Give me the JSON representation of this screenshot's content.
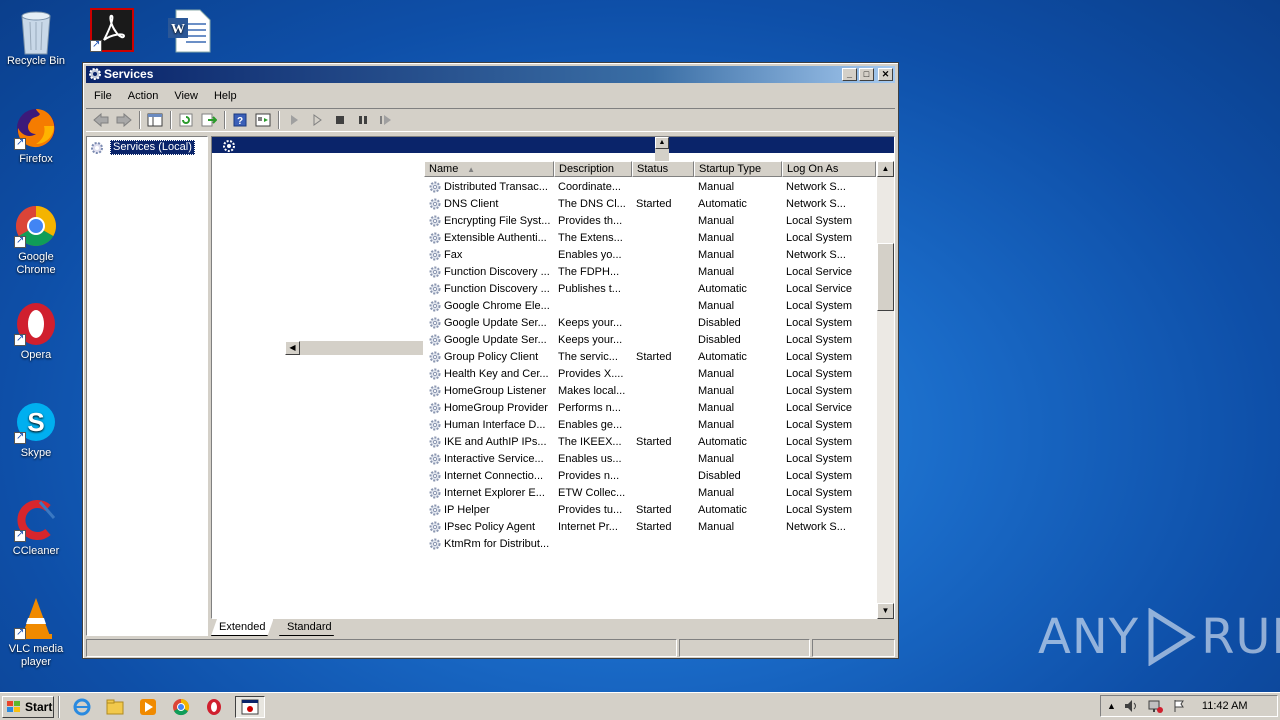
{
  "desktop": {
    "icons": [
      {
        "label": "Recycle Bin",
        "icon": "recycle-bin-icon"
      },
      {
        "label": "",
        "icon": "acrobat-icon"
      },
      {
        "label": "",
        "icon": "word-doc-icon"
      },
      {
        "label": "Firefox",
        "icon": "firefox-icon"
      },
      {
        "label": "Google Chrome",
        "icon": "chrome-icon"
      },
      {
        "label": "Opera",
        "icon": "opera-icon"
      },
      {
        "label": "Skype",
        "icon": "skype-icon"
      },
      {
        "label": "CCleaner",
        "icon": "ccleaner-icon"
      },
      {
        "label": "VLC media player",
        "icon": "vlc-icon"
      }
    ]
  },
  "window": {
    "title": "Services",
    "controls": {
      "minimize": "_",
      "maximize": "□",
      "close": "✕"
    },
    "menu": [
      "File",
      "Action",
      "View",
      "Help"
    ],
    "tree": {
      "root": "Services (Local)"
    },
    "columns": [
      "Name",
      "Description",
      "Status",
      "Startup Type",
      "Log On As"
    ],
    "services": [
      {
        "name": "Distributed Transac...",
        "description": "Coordinate...",
        "status": "",
        "startup": "Manual",
        "logon": "Network S..."
      },
      {
        "name": "DNS Client",
        "description": "The DNS Cl...",
        "status": "Started",
        "startup": "Automatic",
        "logon": "Network S..."
      },
      {
        "name": "Encrypting File Syst...",
        "description": "Provides th...",
        "status": "",
        "startup": "Manual",
        "logon": "Local System"
      },
      {
        "name": "Extensible Authenti...",
        "description": "The Extens...",
        "status": "",
        "startup": "Manual",
        "logon": "Local System"
      },
      {
        "name": "Fax",
        "description": "Enables yo...",
        "status": "",
        "startup": "Manual",
        "logon": "Network S..."
      },
      {
        "name": "Function Discovery ...",
        "description": "The FDPH...",
        "status": "",
        "startup": "Manual",
        "logon": "Local Service"
      },
      {
        "name": "Function Discovery ...",
        "description": "Publishes t...",
        "status": "",
        "startup": "Automatic",
        "logon": "Local Service"
      },
      {
        "name": "Google Chrome Ele...",
        "description": "",
        "status": "",
        "startup": "Manual",
        "logon": "Local System"
      },
      {
        "name": "Google Update Ser...",
        "description": "Keeps your...",
        "status": "",
        "startup": "Disabled",
        "logon": "Local System"
      },
      {
        "name": "Google Update Ser...",
        "description": "Keeps your...",
        "status": "",
        "startup": "Disabled",
        "logon": "Local System"
      },
      {
        "name": "Group Policy Client",
        "description": "The servic...",
        "status": "Started",
        "startup": "Automatic",
        "logon": "Local System"
      },
      {
        "name": "Health Key and Cer...",
        "description": "Provides X....",
        "status": "",
        "startup": "Manual",
        "logon": "Local System"
      },
      {
        "name": "HomeGroup Listener",
        "description": "Makes local...",
        "status": "",
        "startup": "Manual",
        "logon": "Local System"
      },
      {
        "name": "HomeGroup Provider",
        "description": "Performs n...",
        "status": "",
        "startup": "Manual",
        "logon": "Local Service"
      },
      {
        "name": "Human Interface D...",
        "description": "Enables ge...",
        "status": "",
        "startup": "Manual",
        "logon": "Local System"
      },
      {
        "name": "IKE and AuthIP IPs...",
        "description": "The IKEEX...",
        "status": "Started",
        "startup": "Automatic",
        "logon": "Local System"
      },
      {
        "name": "Interactive Service...",
        "description": "Enables us...",
        "status": "",
        "startup": "Manual",
        "logon": "Local System"
      },
      {
        "name": "Internet Connectio...",
        "description": "Provides n...",
        "status": "",
        "startup": "Disabled",
        "logon": "Local System"
      },
      {
        "name": "Internet Explorer E...",
        "description": "ETW Collec...",
        "status": "",
        "startup": "Manual",
        "logon": "Local System"
      },
      {
        "name": "IP Helper",
        "description": "Provides tu...",
        "status": "Started",
        "startup": "Automatic",
        "logon": "Local System"
      },
      {
        "name": "IPsec Policy Agent",
        "description": "Internet Pr...",
        "status": "Started",
        "startup": "Manual",
        "logon": "Network S..."
      },
      {
        "name": "KtmRm for Distribut...",
        "description": "",
        "status": "",
        "startup": "",
        "logon": ""
      }
    ],
    "tabs": [
      "Extended",
      "Standard"
    ],
    "active_tab": "Extended"
  },
  "taskbar": {
    "start_label": "Start",
    "quick_launch": [
      "ie-icon",
      "explorer-icon",
      "media-player-icon",
      "chrome-icon",
      "opera-icon"
    ],
    "active_task": "services-icon",
    "clock": "11:42 AM"
  },
  "watermark": {
    "text_left": "ANY",
    "text_right": "RUN"
  },
  "colors": {
    "titlebar": "#0a246a",
    "selection": "#0a246a",
    "desktop": "#1a6bc8"
  }
}
